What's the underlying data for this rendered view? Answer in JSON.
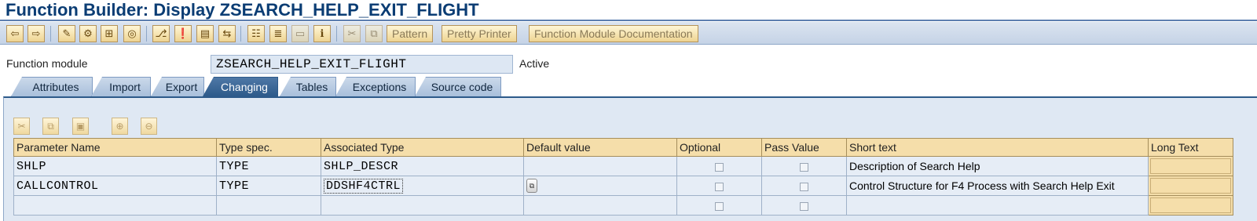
{
  "title": "Function Builder: Display ZSEARCH_HELP_EXIT_FLIGHT",
  "toolbar": {
    "icons": [
      "back-icon",
      "forward-icon",
      "other-object-icon",
      "display-change-icon",
      "activate-icon",
      "check-icon",
      "where-used-icon",
      "test-icon",
      "display-object-list-icon",
      "enhance-icon",
      "navigation-window-icon",
      "info-icon",
      "cut-icon",
      "copy-icon"
    ],
    "pattern_label": "Pattern",
    "pretty_printer_label": "Pretty Printer",
    "fm_doc_label": "Function Module Documentation"
  },
  "function_module": {
    "label": "Function module",
    "value": "ZSEARCH_HELP_EXIT_FLIGHT",
    "status": "Active"
  },
  "tabs": [
    {
      "label": "Attributes",
      "active": false
    },
    {
      "label": "Import",
      "active": false
    },
    {
      "label": "Export",
      "active": false
    },
    {
      "label": "Changing",
      "active": true
    },
    {
      "label": "Tables",
      "active": false
    },
    {
      "label": "Exceptions",
      "active": false
    },
    {
      "label": "Source code",
      "active": false
    }
  ],
  "param_toolbar": {
    "icons": [
      "cut-icon",
      "copy-icon",
      "paste-icon",
      "insert-row-icon",
      "delete-row-icon"
    ]
  },
  "table": {
    "columns": [
      "Parameter Name",
      "Type spec.",
      "Associated Type",
      "Default value",
      "Optional",
      "Pass Value",
      "Short text",
      "Long Text"
    ],
    "rows": [
      {
        "name": "SHLP",
        "type_spec": "TYPE",
        "assoc_type": "SHLP_DESCR",
        "default": "",
        "optional": false,
        "pass_value": false,
        "short_text": "Description of Search Help"
      },
      {
        "name": "CALLCONTROL",
        "type_spec": "TYPE",
        "assoc_type": "DDSHF4CTRL",
        "default": "",
        "optional": false,
        "pass_value": false,
        "short_text": "Control Structure for F4 Process with Search Help Exit"
      },
      {
        "name": "",
        "type_spec": "",
        "assoc_type": "",
        "default": "",
        "optional": false,
        "pass_value": false,
        "short_text": ""
      }
    ]
  }
}
